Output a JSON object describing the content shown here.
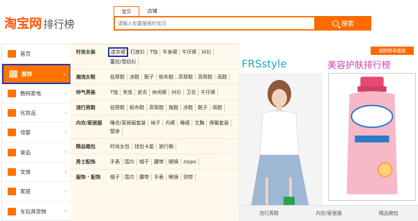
{
  "header": {
    "logo_main": "淘宝网",
    "logo_sub": "排行榜",
    "search_tabs": [
      "宝贝",
      "店铺"
    ],
    "search_placeholder": "请输入你要搜索的宝贝",
    "search_button": "搜索"
  },
  "sidebar": {
    "items": [
      {
        "label": "首页"
      },
      {
        "label": "服饰"
      },
      {
        "label": "数码家电"
      },
      {
        "label": "化妆品"
      },
      {
        "label": "母婴"
      },
      {
        "label": "食品"
      },
      {
        "label": "文体"
      },
      {
        "label": "家居"
      },
      {
        "label": "车玩具宠物"
      }
    ]
  },
  "categories": [
    {
      "title": "时尚女装",
      "links": [
        "连衣裙",
        "打底衫",
        "T恤",
        "半身裙",
        "牛仔裤",
        "衬衫",
        "蕾丝/雪纺衫"
      ]
    },
    {
      "title": "潮流女鞋",
      "links": [
        "低帮鞋",
        "凉鞋",
        "靴子",
        "帆布鞋",
        "高帮鞋",
        "高帮鞋",
        "雨鞋"
      ]
    },
    {
      "title": "帅气男装",
      "links": [
        "T恤",
        "夹克",
        "皮衣",
        "休闲裤",
        "衬衫",
        "卫衣",
        "牛仔裤"
      ]
    },
    {
      "title": "流行男鞋",
      "links": [
        "低帮鞋",
        "帆布鞋",
        "高帮鞋",
        "拖鞋",
        "凉鞋",
        "靴子",
        "雨鞋"
      ]
    },
    {
      "title": "内衣/家居服",
      "links": [
        "睡衣/家居服套装",
        "袜子",
        "内裤",
        "睡裙",
        "文胸",
        "保暖套装",
        "塑身"
      ]
    },
    {
      "title": "精品箱包",
      "links": [
        "时尚女包",
        "钱包卡套",
        "旅行箱"
      ]
    },
    {
      "title": "男士配饰",
      "links": [
        "手表",
        "围巾",
        "帽子",
        "腰带",
        "眼镜",
        "zippo"
      ]
    },
    {
      "title": "服饰 · 配饰",
      "links": [
        "帽子",
        "围巾",
        "腰带",
        "手表",
        "眼镜",
        "领带"
      ]
    }
  ],
  "promo": {
    "top_button": "跳转榜单播放",
    "label_a": "FRSstyle",
    "label_b": "美容护肤排行榜",
    "tabs": [
      "流行男鞋",
      "内衣/家居服",
      "精品箱包"
    ]
  },
  "colors": {
    "accent": "#ff7300",
    "highlight_border": "#2233aa",
    "panel_bg": "#fff9ec"
  }
}
